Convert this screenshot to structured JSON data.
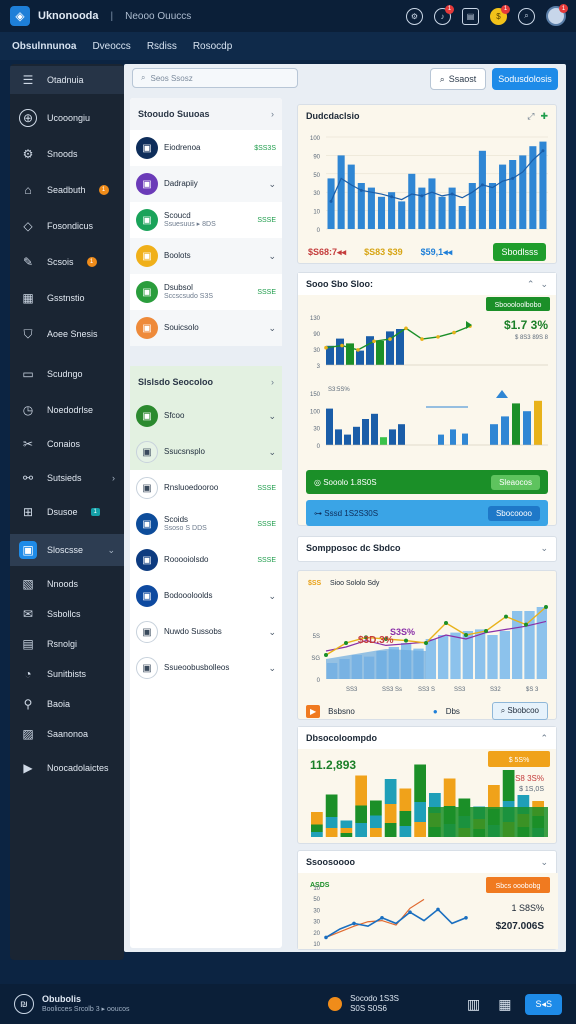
{
  "app": {
    "title": "Uknonooda",
    "subtitle": "Neooo Ouuccs"
  },
  "topbar": {
    "icons": [
      "settings-icon",
      "notification-icon",
      "chat-icon",
      "coin-icon",
      "search-icon",
      "avatar"
    ],
    "badges": [
      "1",
      "1",
      "1"
    ]
  },
  "menu": [
    "Obsulnnunoa",
    "Dveoccs",
    "Rsdiss",
    "Rosocdp"
  ],
  "sidebar": [
    {
      "label": "Otadnuia",
      "icon": "menu-icon"
    },
    {
      "label": "Ucooongiu",
      "icon": "globe-icon"
    },
    {
      "label": "Snoods",
      "icon": "gear-icon"
    },
    {
      "label": "Seadbuth",
      "icon": "bank-icon",
      "badge": "1"
    },
    {
      "label": "Fosondicus",
      "icon": "tag-icon"
    },
    {
      "label": "Scsois",
      "icon": "pin-icon",
      "badge": "1"
    },
    {
      "label": "Gsstnstio",
      "icon": "grid-icon"
    },
    {
      "label": "Aoee Snesis",
      "icon": "shield-icon"
    },
    {
      "label": "Scudngo",
      "icon": "chat-icon"
    },
    {
      "label": "Noedodrlse",
      "icon": "clock-icon"
    },
    {
      "label": "Conaios",
      "icon": "wrench-icon"
    },
    {
      "label": "Sutsieds",
      "icon": "link-icon",
      "chev": "›"
    },
    {
      "label": "Dsusoe",
      "icon": "table-icon",
      "tag": "1"
    },
    {
      "label": "Sloscsse",
      "icon": "folder-icon",
      "chev": "⌄"
    },
    {
      "label": "Nnoods",
      "icon": "doc-icon"
    },
    {
      "label": "Ssbollcs",
      "icon": "mail-icon"
    },
    {
      "label": "Rsnolgi",
      "icon": "image-icon"
    },
    {
      "label": "Sunitbists",
      "icon": "pie-icon"
    },
    {
      "label": "Baoia",
      "icon": "person-icon"
    },
    {
      "label": "Saanonoa",
      "icon": "inbox-icon"
    },
    {
      "label": "Noocadolaictes",
      "icon": "play-icon"
    }
  ],
  "search": {
    "placeholder": "Seos Ssosz"
  },
  "actions": {
    "search": "Ssaost",
    "primary": "Sodusdolosis"
  },
  "list": {
    "head": "Stooudo Suuoas",
    "items": [
      {
        "title": "Eiodrenoa",
        "sub": "",
        "val": "$SS3S",
        "color": "#0e2d5a"
      },
      {
        "title": "Dadrapiiy",
        "sub": "",
        "val": "",
        "color": "#6b3bb8",
        "badge": "😊"
      },
      {
        "title": "Scoucd",
        "sub": "Ssuesuus  ▸ 8DS",
        "val": "SSSE",
        "color": "#1aa35a"
      },
      {
        "title": "Boolots",
        "sub": "",
        "val": "",
        "color": "#f0b01a"
      },
      {
        "title": "Dsubsol",
        "sub": "Sccscsudo  S3S",
        "val": "SSSE",
        "color": "#2a9d3c"
      },
      {
        "title": "Souicsolo",
        "sub": "",
        "val": "",
        "color": "#ee8a3a"
      }
    ],
    "head2": "Slslsdo Seocoloo",
    "items2": [
      {
        "title": "Sfcoo",
        "sub": "",
        "val": "",
        "color": "#2b8a2e"
      },
      {
        "title": "Ssucsnsplo",
        "sub": "",
        "val": "",
        "color": "#e6f2e6"
      },
      {
        "title": "Rnsluoedooroo",
        "sub": "",
        "val": "SSSE",
        "color": "#ffffff"
      },
      {
        "title": "Scoids",
        "sub": "Ssoso S DDS",
        "val": "SSSE",
        "color": "#0d4c9a"
      },
      {
        "title": "Rooooiolsdo",
        "sub": "",
        "val": "SSSE",
        "color": "#0d3b80"
      },
      {
        "title": "Bodoooloolds",
        "sub": "",
        "val": "",
        "color": "#0e4aa0"
      },
      {
        "title": "Nuwdo Sussobs",
        "sub": "",
        "val": "",
        "color": "#ffffff"
      },
      {
        "title": "Ssueoobusbolleos",
        "sub": "",
        "val": "",
        "color": "#ffffff"
      }
    ]
  },
  "card1": {
    "title": "Dudcdaclsio",
    "stats": [
      "$S68:7◂◂",
      "$S83 $39",
      "$59,1◂◂"
    ],
    "button": "Sbodlsss",
    "chart_data": {
      "type": "bar",
      "values": [
        55,
        80,
        70,
        50,
        45,
        35,
        40,
        30,
        60,
        45,
        55,
        35,
        45,
        25,
        50,
        85,
        50,
        70,
        75,
        80,
        90,
        95
      ],
      "line": [
        30,
        55,
        48,
        42,
        40,
        38,
        35,
        32,
        38,
        36,
        40,
        36,
        38,
        34,
        40,
        48,
        45,
        52,
        55,
        62,
        75,
        85
      ],
      "ylim": [
        0,
        100
      ],
      "ticks": [
        "100",
        "90",
        "50",
        "30",
        "10",
        "0"
      ]
    }
  },
  "card2": {
    "title": "Sooo Sbo Sloo:",
    "badge": "Sboooloolbobo",
    "big": "$1.7 3%",
    "sub": "$ 8S3 89S 8",
    "top_line": [
      40,
      45,
      35,
      55,
      60,
      85,
      60,
      65,
      75,
      90
    ],
    "top_bars": [
      40,
      55,
      45,
      30,
      60,
      50,
      70,
      75
    ],
    "bot_bars": [
      70,
      30,
      20,
      35,
      50,
      60,
      15,
      30,
      40
    ],
    "bot_small": [
      20,
      30,
      22
    ],
    "bot_right": [
      40,
      55,
      80,
      65,
      85
    ],
    "label_top": "S3:5S%",
    "yt1": [
      "130",
      "90",
      "30",
      "3"
    ],
    "yt2": [
      "150",
      "100",
      "30",
      "0"
    ],
    "green_bar": "Sooolo  1.8S0S",
    "green_btn": "Sleaocos",
    "blue_bar": "Sssd 1S2S30S",
    "blue_btn": "Sbocoooo"
  },
  "card3": {
    "title": "Sompposoc dc Sbdco"
  },
  "card4": {
    "title": "Sioo Sololo Sdy",
    "tag": "$SS",
    "pct1": "$3D.3%",
    "pct2": "S3S%",
    "yt": [
      "5S",
      "SG",
      "0"
    ],
    "xl": [
      "SS3",
      "SS3 Ss",
      "SS3 S",
      "SS3",
      "S32",
      "$S 3"
    ],
    "bars": [
      20,
      25,
      30,
      28,
      35,
      40,
      45,
      38,
      50,
      55,
      58,
      60,
      62,
      55,
      60,
      85,
      85,
      90
    ],
    "line1": [
      30,
      45,
      52,
      50,
      48,
      45,
      70,
      55,
      60,
      78,
      68,
      90
    ],
    "line2": [
      35,
      40,
      48,
      42,
      44,
      46,
      55,
      50,
      58,
      62,
      66,
      72
    ],
    "footer": [
      "Bsbsno",
      "Dbs",
      "Sbobcoo"
    ]
  },
  "card5": {
    "title": "Dbsocoloompdo",
    "big": "11.2,893",
    "badge": "$ 5S%",
    "pct": "1 S8 3S%",
    "sub": "$ 1S,0S",
    "chart_data": {
      "type": "bar",
      "series": [
        [
          25,
          45,
          15,
          60,
          30,
          50,
          45,
          75,
          40,
          55,
          35,
          25,
          48,
          62,
          38,
          30
        ],
        [
          15,
          22,
          10,
          35,
          25,
          38,
          30,
          40,
          28,
          36,
          24,
          20,
          32,
          42,
          26,
          24
        ],
        [
          10,
          18,
          8,
          28,
          18,
          28,
          22,
          30,
          20,
          26,
          18,
          16,
          24,
          30,
          20,
          18
        ]
      ]
    }
  },
  "card6": {
    "title": "Ssoosoooo",
    "tag": "ASDS",
    "badge": "Sbcs ooobobg",
    "pct": "1 S8S%",
    "big": "$207.006S",
    "yt": [
      "10",
      "50",
      "30",
      "30",
      "20",
      "10"
    ],
    "line1": [
      10,
      25,
      35,
      30,
      45,
      35,
      55,
      40,
      60,
      35,
      45
    ],
    "line2": [
      10,
      20,
      30,
      38,
      40,
      32,
      62,
      78
    ]
  },
  "bottom": {
    "name": "Obubolis",
    "sub": "Boolicces Srcolb 3 ▸ ooucos",
    "mid1": "Socodo  1S3S",
    "mid2": "S0S    S0S6",
    "btn": "S◂S"
  }
}
